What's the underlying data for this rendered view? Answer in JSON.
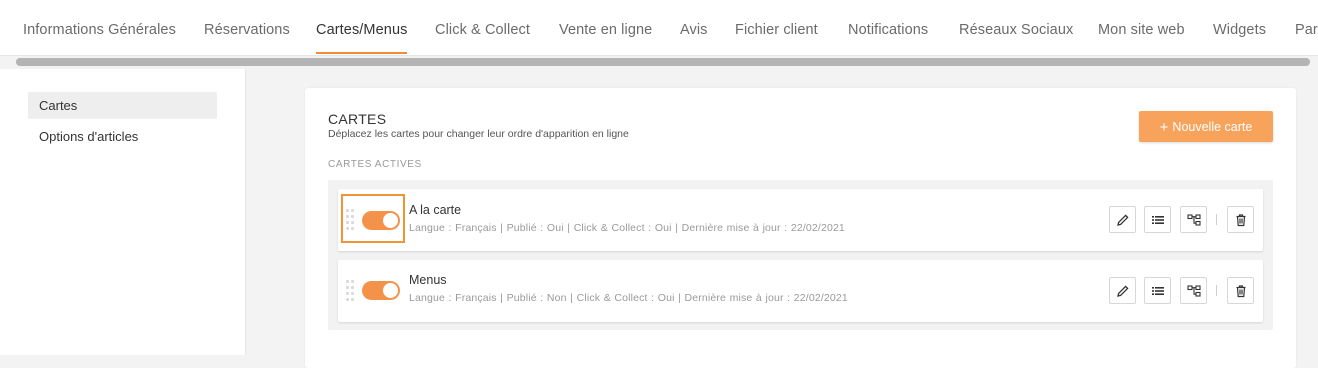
{
  "nav": {
    "tabs": [
      {
        "label": "Informations Générales"
      },
      {
        "label": "Réservations"
      },
      {
        "label": "Cartes/Menus"
      },
      {
        "label": "Click & Collect"
      },
      {
        "label": "Vente en ligne"
      },
      {
        "label": "Avis"
      },
      {
        "label": "Fichier client"
      },
      {
        "label": "Notifications"
      },
      {
        "label": "Réseaux Sociaux"
      },
      {
        "label": "Mon site web"
      },
      {
        "label": "Widgets"
      },
      {
        "label": "Par"
      }
    ],
    "active_tab": "Cartes/Menus"
  },
  "sidebar": {
    "items": [
      {
        "label": "Cartes"
      },
      {
        "label": "Options d'articles"
      }
    ]
  },
  "panel": {
    "title": "CARTES",
    "subtitle": "Déplacez les cartes pour changer leur ordre d'apparition en ligne",
    "new_button_label": "Nouvelle carte",
    "new_button_icon": "+",
    "active_section_label": "CARTES ACTIVES",
    "cards": [
      {
        "title": "A la carte",
        "meta": "Langue : Français  |  Publié : Oui  |  Click & Collect : Oui  |  Dernière mise à jour : 22/02/2021",
        "enabled": true
      },
      {
        "title": "Menus",
        "meta": "Langue : Français  |  Publié : Non  |  Click & Collect : Oui  |  Dernière mise à jour : 22/02/2021",
        "enabled": true
      }
    ]
  },
  "colors": {
    "accent": "#f7a35c",
    "toggle_on": "#f5924a",
    "highlight_border": "#f09436"
  },
  "icons": [
    "pencil-icon",
    "list-icon",
    "hierarchy-icon",
    "trash-icon",
    "drag-handle-icon",
    "plus-icon"
  ]
}
